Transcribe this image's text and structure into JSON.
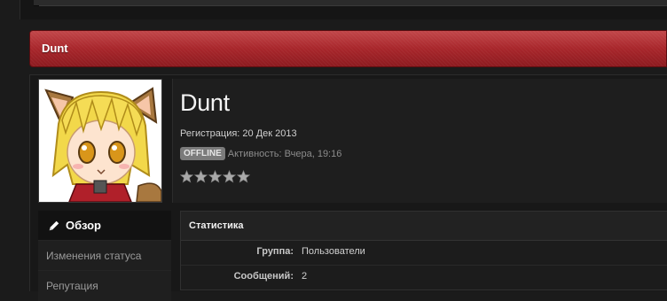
{
  "header": {
    "title": "Dunt"
  },
  "profile": {
    "username": "Dunt",
    "registration": "Регистрация: 20 Дек 2013",
    "status_badge": "OFFLINE",
    "activity": "Активность: Вчера, 19:16",
    "rating_stars": 0,
    "rating_max": 5
  },
  "sidenav": {
    "items": [
      {
        "label": "Обзор",
        "active": true,
        "icon": "pencil-icon"
      },
      {
        "label": "Изменения статуса",
        "active": false
      },
      {
        "label": "Репутация",
        "active": false
      }
    ]
  },
  "stats": {
    "title": "Статистика",
    "rows": [
      {
        "key": "Группа:",
        "value": "Пользователи"
      },
      {
        "key": "Сообщений:",
        "value": "2"
      }
    ]
  },
  "colors": {
    "header_red": "#a8262b",
    "background": "#1b1b1b",
    "badge_gray": "#7b7b7b"
  }
}
